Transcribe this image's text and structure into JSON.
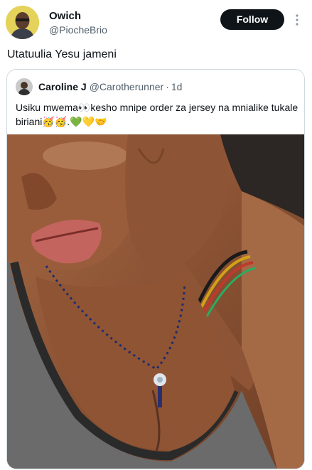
{
  "post": {
    "author_name": "Owich",
    "author_handle": "@PiocheBrio",
    "follow_label": "Follow",
    "text": "Utatuulia Yesu jameni",
    "icons": {
      "more": "more-vertical-icon"
    }
  },
  "quote": {
    "author_name": "Caroline J",
    "author_handle": "@Carotherunner",
    "dot": "·",
    "time": "1d",
    "text": "Usiku mwema👀kesho mnipe order za jersey na mnialike tukale biriani🥳🥳.💚💛🤝"
  },
  "colors": {
    "follow_bg": "#0f1419",
    "handle": "#53606b",
    "card_border": "#cfd9de",
    "profile_bg": "#e8d55a"
  }
}
